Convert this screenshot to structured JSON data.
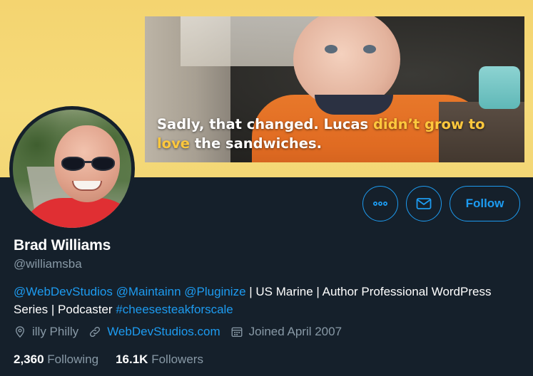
{
  "banner": {
    "caption_part1": "Sadly, that changed. Lucas ",
    "caption_highlight1": "didn’t grow to",
    "caption_highlight2": "love",
    "caption_part2": " the sandwiches."
  },
  "profile": {
    "name": "Brad Williams",
    "handle": "@williamsba",
    "bio": {
      "mention1": "@WebDevStudios",
      "mention2": "@Maintainn",
      "mention3": "@Pluginize",
      "text1": " | US Marine | Author Professional WordPress Series | Podcaster ",
      "hashtag": "#cheesesteakforscale"
    },
    "location": "illy Philly",
    "website": "WebDevStudios.com",
    "joined": "Joined April 2007"
  },
  "actions": {
    "more_icon": "more-icon",
    "message_icon": "envelope-icon",
    "follow_label": "Follow"
  },
  "stats": {
    "following_count": "2,360",
    "following_label": "Following",
    "followers_count": "16.1K",
    "followers_label": "Followers"
  },
  "colors": {
    "background": "#15202b",
    "accent": "#1d9bf0",
    "secondary_text": "#8899a6",
    "banner_bg": "#f4d470",
    "caption_highlight": "#ffc83d"
  }
}
